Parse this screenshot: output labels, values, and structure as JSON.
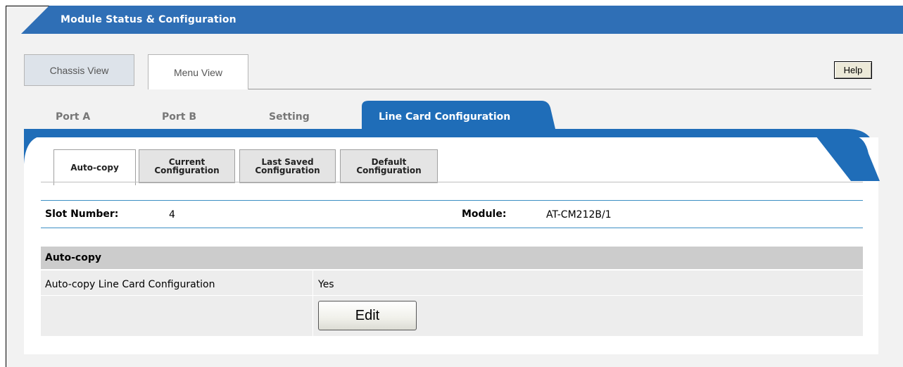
{
  "header": {
    "title": "Module Status & Configuration"
  },
  "view_tabs": [
    {
      "label": "Chassis View",
      "active": false
    },
    {
      "label": "Menu View",
      "active": true
    }
  ],
  "help_label": "Help",
  "port_tabs": [
    {
      "label": "Port A",
      "active": false
    },
    {
      "label": "Port B",
      "active": false
    },
    {
      "label": "Setting",
      "active": false
    },
    {
      "label": "Line Card Configuration",
      "active": true
    }
  ],
  "sub_tabs": [
    {
      "line1": "Auto-copy",
      "line2": "",
      "active": true
    },
    {
      "line1": "Current",
      "line2": "Configuration",
      "active": false
    },
    {
      "line1": "Last Saved",
      "line2": "Configuration",
      "active": false
    },
    {
      "line1": "Default",
      "line2": "Configuration",
      "active": false
    }
  ],
  "info": {
    "slot_label": "Slot Number:",
    "slot_value": "4",
    "module_label": "Module:",
    "module_value": "AT-CM212B/1"
  },
  "section": {
    "title": "Auto-copy",
    "row_label": "Auto-copy Line Card Configuration",
    "row_value": "Yes",
    "edit_label": "Edit"
  },
  "colors": {
    "header_blue": "#2f6fb6",
    "tab_blue": "#1f6db8",
    "rule_blue": "#3d8fc4",
    "section_gray": "#cccccc"
  }
}
